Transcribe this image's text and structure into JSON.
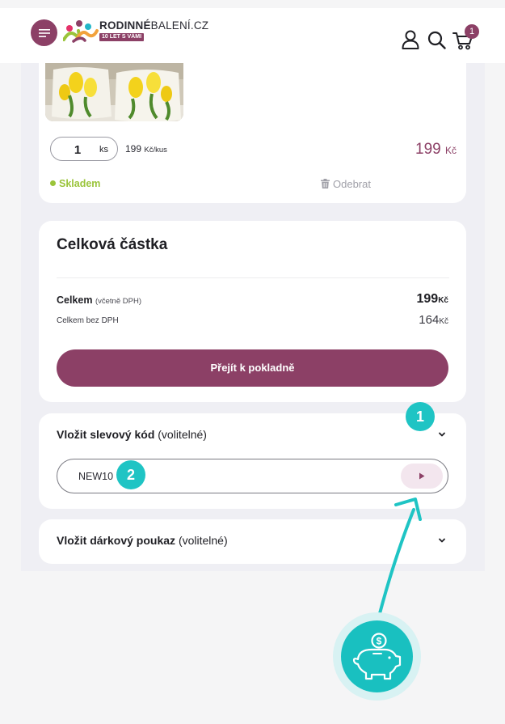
{
  "header": {
    "brand_bold": "RODINNÉ",
    "brand_thin": "BALENÍ.CZ",
    "brand_badge": "10 LET S VÁMI",
    "cart_count": "1",
    "icons": [
      "menu-icon",
      "brand-logo",
      "user-icon",
      "search-icon",
      "cart-icon"
    ]
  },
  "cart_item": {
    "quantity": "1",
    "quantity_unit": "ks",
    "unit_price": "199",
    "unit_price_suffix": "Kč/kus",
    "line_price": "199",
    "line_currency": "Kč",
    "stock_status": "Skladem",
    "remove_label": "Odebrat"
  },
  "summary": {
    "title": "Celková částka",
    "total_label": "Celkem",
    "total_note": "(včetně DPH)",
    "total_value": "199",
    "net_label": "Celkem bez DPH",
    "net_value": "164",
    "currency": "Kč",
    "checkout_label": "Přejít k pokladně"
  },
  "coupon": {
    "label_bold": "Vložit slevový kód",
    "label_rest": "(volitelné)",
    "value": "NEW10"
  },
  "gift": {
    "label_bold": "Vložit dárkový poukaz",
    "label_rest": "(volitelné)"
  },
  "markers": {
    "first": "1",
    "second": "2"
  },
  "colors": {
    "brand": "#8c4066",
    "accent_teal": "#1fc4c4",
    "stock_green": "#9ac43a",
    "page_bg": "#efeff4"
  }
}
